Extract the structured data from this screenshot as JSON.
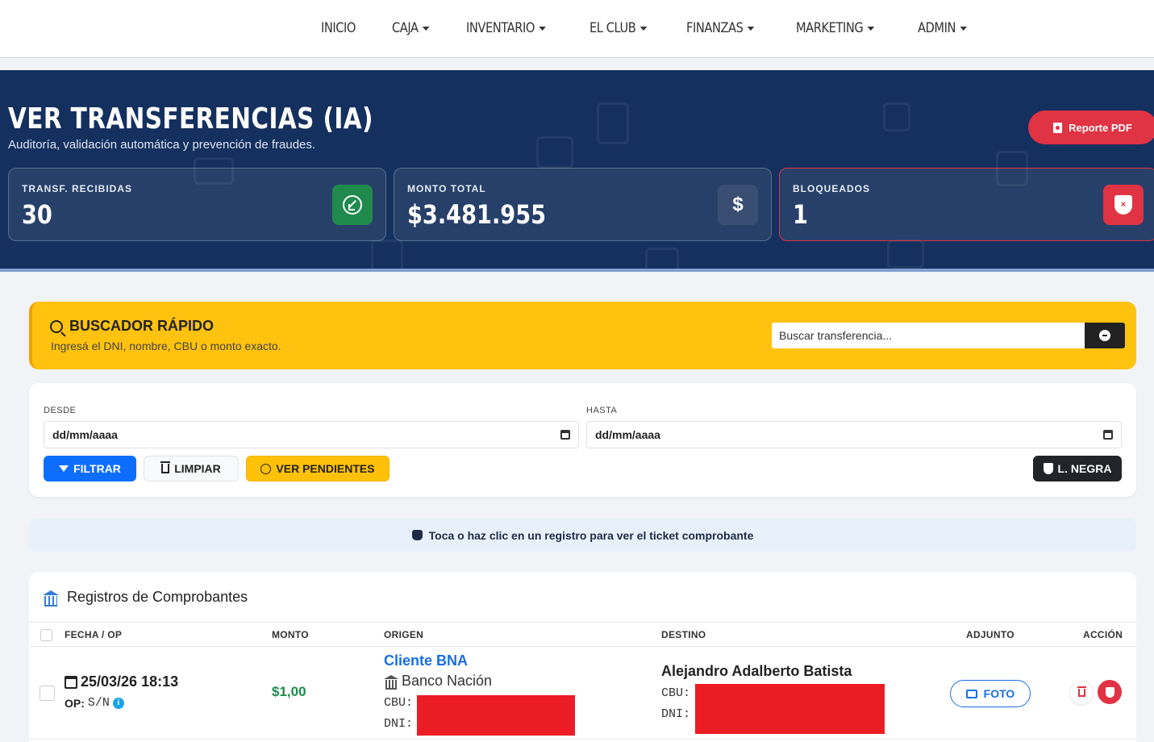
{
  "nav": {
    "items": [
      {
        "label": "INICIO",
        "dropdown": false
      },
      {
        "label": "CAJA",
        "dropdown": true
      },
      {
        "label": "INVENTARIO",
        "dropdown": true
      },
      {
        "label": "EL CLUB",
        "dropdown": true
      },
      {
        "label": "FINANZAS",
        "dropdown": true
      },
      {
        "label": "MARKETING",
        "dropdown": true
      },
      {
        "label": "ADMIN",
        "dropdown": true
      }
    ]
  },
  "hero": {
    "title": "VER TRANSFERENCIAS (IA)",
    "subtitle": "Auditoría, validación automática y prevención de fraudes.",
    "pdf_button": "Reporte PDF",
    "stats": [
      {
        "label": "TRANSF. RECIBIDAS",
        "value": "30",
        "icon": "arrow-in-icon"
      },
      {
        "label": "MONTO TOTAL",
        "value": "$3.481.955",
        "icon": "dollar-icon",
        "icon_text": "$"
      },
      {
        "label": "BLOQUEADOS",
        "value": "1",
        "icon": "shield-x-icon",
        "icon_text": "×"
      }
    ]
  },
  "search": {
    "title": "BUSCADOR RÁPIDO",
    "subtitle": "Ingresá el DNI, nombre, CBU o monto exacto.",
    "placeholder": "Buscar transferencia..."
  },
  "filters": {
    "from_label": "DESDE",
    "to_label": "HASTA",
    "from_value": "dd/mm/aaaa",
    "to_value": "dd/mm/aaaa",
    "filter_button": "FILTRAR",
    "clear_button": "LIMPIAR",
    "pending_button": "VER PENDIENTES",
    "blacklist_button": "L. NEGRA"
  },
  "info": {
    "text": "Toca o haz clic en un registro para ver el ticket comprobante"
  },
  "table": {
    "title": "Registros de Comprobantes",
    "columns": [
      "FECHA / OP",
      "MONTO",
      "ORIGEN",
      "DESTINO",
      "ADJUNTO",
      "ACCIÓN"
    ],
    "rows": [
      {
        "date": "25/03/26 18:13",
        "op_label": "OP:",
        "op_value": "S/N",
        "amount": "$1,00",
        "origin_name": "Cliente BNA",
        "origin_bank": "Banco Nación",
        "cbu_label": "CBU:",
        "dni_label": "DNI:",
        "dest_name": "Alejandro Adalberto Batista",
        "attach_button": "FOTO"
      }
    ]
  },
  "colors": {
    "hero_bg": "#14305e",
    "accent_yellow": "#ffc20e",
    "danger": "#e03344",
    "primary": "#0d6efd",
    "success": "#1f8a4c"
  }
}
